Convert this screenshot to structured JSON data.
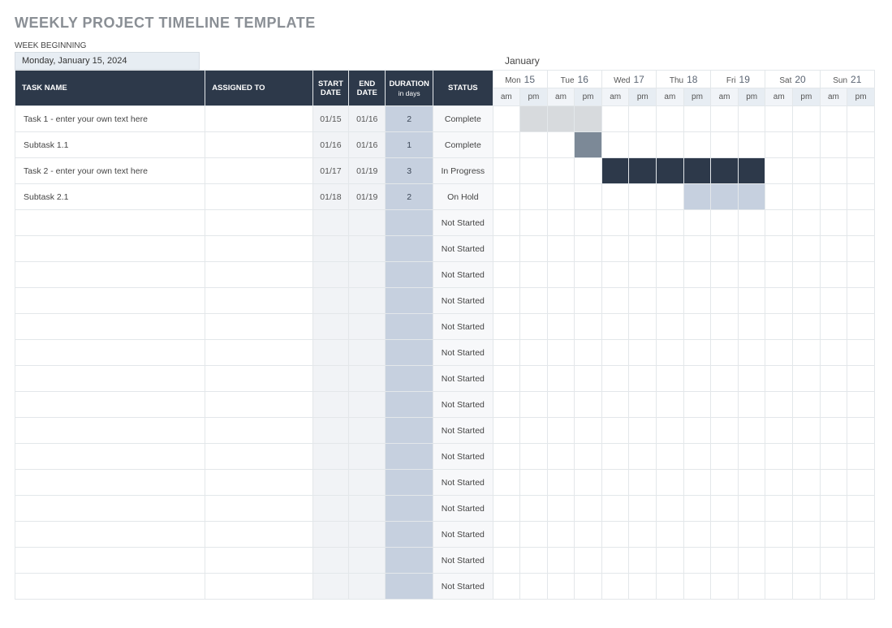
{
  "title": "WEEKLY PROJECT TIMELINE TEMPLATE",
  "week_begin_label": "WEEK BEGINNING",
  "week_begin_value": "Monday, January 15, 2024",
  "month": "January",
  "days": [
    {
      "abbr": "Mon",
      "num": "15"
    },
    {
      "abbr": "Tue",
      "num": "16"
    },
    {
      "abbr": "Wed",
      "num": "17"
    },
    {
      "abbr": "Thu",
      "num": "18"
    },
    {
      "abbr": "Fri",
      "num": "19"
    },
    {
      "abbr": "Sat",
      "num": "20"
    },
    {
      "abbr": "Sun",
      "num": "21"
    }
  ],
  "half_labels": {
    "am": "am",
    "pm": "pm"
  },
  "headers": {
    "taskname": "TASK NAME",
    "assigned": "ASSIGNED TO",
    "start": "START DATE",
    "end": "END DATE",
    "duration": "DURATION",
    "duration_sub": "in days",
    "status": "STATUS"
  },
  "rows": [
    {
      "task": "Task 1 - enter your own text here",
      "assigned": "",
      "start": "01/15",
      "end": "01/16",
      "dur": "2",
      "status": "Complete",
      "bar": {
        "start": 1,
        "end": 3,
        "color": "clr1"
      }
    },
    {
      "task": "Subtask 1.1",
      "assigned": "",
      "start": "01/16",
      "end": "01/16",
      "dur": "1",
      "status": "Complete",
      "bar": {
        "start": 3,
        "end": 3,
        "color": "clr2"
      }
    },
    {
      "task": "Task 2 - enter your own text here",
      "assigned": "",
      "start": "01/17",
      "end": "01/19",
      "dur": "3",
      "status": "In Progress",
      "bar": {
        "start": 4,
        "end": 9,
        "color": "clr3"
      }
    },
    {
      "task": "Subtask 2.1",
      "assigned": "",
      "start": "01/18",
      "end": "01/19",
      "dur": "2",
      "status": "On Hold",
      "bar": {
        "start": 7,
        "end": 9,
        "color": "clr4"
      }
    },
    {
      "task": "",
      "assigned": "",
      "start": "",
      "end": "",
      "dur": "",
      "status": "Not Started",
      "bar": null
    },
    {
      "task": "",
      "assigned": "",
      "start": "",
      "end": "",
      "dur": "",
      "status": "Not Started",
      "bar": null
    },
    {
      "task": "",
      "assigned": "",
      "start": "",
      "end": "",
      "dur": "",
      "status": "Not Started",
      "bar": null
    },
    {
      "task": "",
      "assigned": "",
      "start": "",
      "end": "",
      "dur": "",
      "status": "Not Started",
      "bar": null
    },
    {
      "task": "",
      "assigned": "",
      "start": "",
      "end": "",
      "dur": "",
      "status": "Not Started",
      "bar": null
    },
    {
      "task": "",
      "assigned": "",
      "start": "",
      "end": "",
      "dur": "",
      "status": "Not Started",
      "bar": null
    },
    {
      "task": "",
      "assigned": "",
      "start": "",
      "end": "",
      "dur": "",
      "status": "Not Started",
      "bar": null
    },
    {
      "task": "",
      "assigned": "",
      "start": "",
      "end": "",
      "dur": "",
      "status": "Not Started",
      "bar": null
    },
    {
      "task": "",
      "assigned": "",
      "start": "",
      "end": "",
      "dur": "",
      "status": "Not Started",
      "bar": null
    },
    {
      "task": "",
      "assigned": "",
      "start": "",
      "end": "",
      "dur": "",
      "status": "Not Started",
      "bar": null
    },
    {
      "task": "",
      "assigned": "",
      "start": "",
      "end": "",
      "dur": "",
      "status": "Not Started",
      "bar": null
    },
    {
      "task": "",
      "assigned": "",
      "start": "",
      "end": "",
      "dur": "",
      "status": "Not Started",
      "bar": null
    },
    {
      "task": "",
      "assigned": "",
      "start": "",
      "end": "",
      "dur": "",
      "status": "Not Started",
      "bar": null
    },
    {
      "task": "",
      "assigned": "",
      "start": "",
      "end": "",
      "dur": "",
      "status": "Not Started",
      "bar": null
    },
    {
      "task": "",
      "assigned": "",
      "start": "",
      "end": "",
      "dur": "",
      "status": "Not Started",
      "bar": null
    }
  ]
}
